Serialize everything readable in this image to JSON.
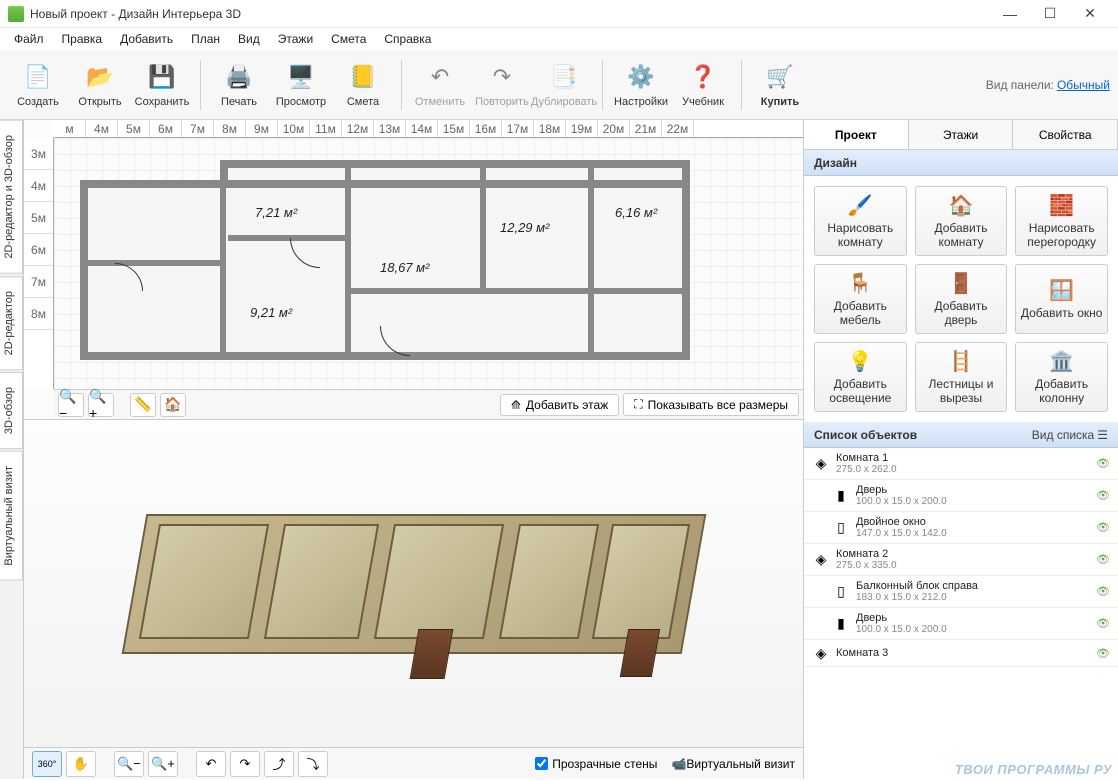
{
  "window": {
    "title": "Новый проект - Дизайн Интерьера 3D"
  },
  "menu": [
    "Файл",
    "Правка",
    "Добавить",
    "План",
    "Вид",
    "Этажи",
    "Смета",
    "Справка"
  ],
  "toolbar": {
    "create": "Создать",
    "open": "Открыть",
    "save": "Сохранить",
    "print": "Печать",
    "preview": "Просмотр",
    "estimate": "Смета",
    "undo": "Отменить",
    "redo": "Повторить",
    "duplicate": "Дублировать",
    "settings": "Настройки",
    "tutorial": "Учебник",
    "buy": "Купить",
    "panel_label": "Вид панели:",
    "panel_mode": "Обычный"
  },
  "vtabs": {
    "combo": "2D-редактор и 3D-обзор",
    "editor2d": "2D-редактор",
    "view3d": "3D-обзор",
    "virtual": "Виртуальный визит"
  },
  "ruler_h": [
    "м",
    "4м",
    "5м",
    "6м",
    "7м",
    "8м",
    "9м",
    "10м",
    "11м",
    "12м",
    "13м",
    "14м",
    "15м",
    "16м",
    "17м",
    "18м",
    "19м",
    "20м",
    "21м",
    "22м"
  ],
  "ruler_v": [
    "3м",
    "4м",
    "5м",
    "6м",
    "7м",
    "8м"
  ],
  "rooms": {
    "r1": "7,21 м²",
    "r2": "18,67 м²",
    "r3": "12,29 м²",
    "r4": "6,16 м²",
    "r5": "9,21 м²"
  },
  "plan_bar": {
    "add_floor": "Добавить этаж",
    "show_dims": "Показывать все размеры"
  },
  "view3d_bar": {
    "transparent": "Прозрачные стены",
    "virtual": "Виртуальный визит"
  },
  "rtabs": {
    "project": "Проект",
    "floors": "Этажи",
    "props": "Свойства"
  },
  "design_hdr": "Дизайн",
  "tools": {
    "draw_room": "Нарисовать комнату",
    "add_room": "Добавить комнату",
    "draw_partition": "Нарисовать перегородку",
    "add_furniture": "Добавить мебель",
    "add_door": "Добавить дверь",
    "add_window": "Добавить окно",
    "add_lighting": "Добавить освещение",
    "stairs": "Лестницы и вырезы",
    "add_column": "Добавить колонну"
  },
  "objlist_hdr": "Список объектов",
  "list_mode": "Вид списка",
  "objects": [
    {
      "name": "Комната 1",
      "dim": "275.0 x 262.0",
      "icon": "◈"
    },
    {
      "name": "Дверь",
      "dim": "100.0 x 15.0 x 200.0",
      "icon": "▮",
      "child": true
    },
    {
      "name": "Двойное окно",
      "dim": "147.0 x 15.0 x 142.0",
      "icon": "▯",
      "child": true
    },
    {
      "name": "Комната 2",
      "dim": "275.0 x 335.0",
      "icon": "◈"
    },
    {
      "name": "Балконный блок справа",
      "dim": "183.0 x 15.0 x 212.0",
      "icon": "▯",
      "child": true
    },
    {
      "name": "Дверь",
      "dim": "100.0 x 15.0 x 200.0",
      "icon": "▮",
      "child": true
    },
    {
      "name": "Комната 3",
      "dim": "",
      "icon": "◈"
    }
  ],
  "watermark": "ТВОИ ПРОГРАММЫ РУ"
}
